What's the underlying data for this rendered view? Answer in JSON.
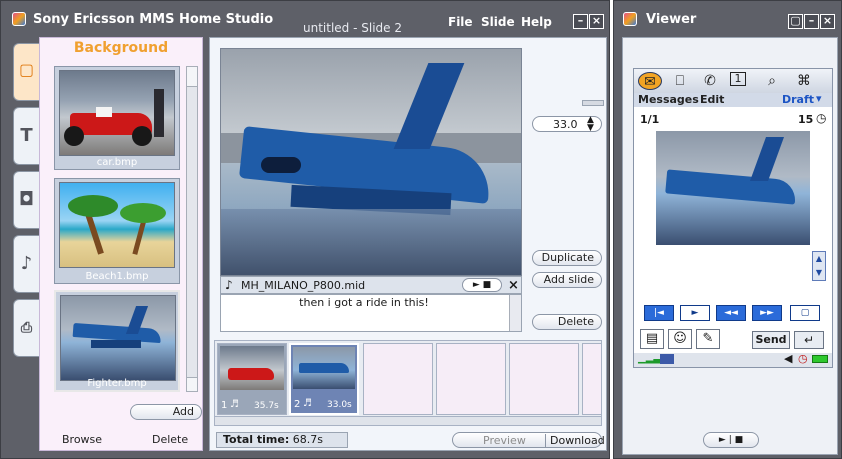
{
  "app": {
    "title": "Sony Ericsson MMS Home Studio",
    "doc_title": "untitled - Slide 2",
    "menu": [
      "File",
      "Slide",
      "Help"
    ]
  },
  "left_panel": {
    "header": "Background",
    "thumbnails": [
      {
        "caption": "car.bmp"
      },
      {
        "caption": "Beach1.bmp"
      },
      {
        "caption": "Fighter.bmp"
      }
    ],
    "add_label": "Add",
    "browse_label": "Browse",
    "delete_label": "Delete"
  },
  "tabs": [
    {
      "icon": "image-icon",
      "glyph": "▢"
    },
    {
      "icon": "text-icon",
      "glyph": "T"
    },
    {
      "icon": "frame-icon",
      "glyph": "◘"
    },
    {
      "icon": "music-note-icon",
      "glyph": "♪"
    },
    {
      "icon": "microphone-icon",
      "glyph": "⎙"
    }
  ],
  "editor": {
    "audio_file": "MH_MILANO_P800.mid",
    "caption_text": "then i got a ride in this!",
    "duration_value": "33.0",
    "duplicate_label": "Duplicate",
    "add_slide_label": "Add slide",
    "delete_label": "Delete"
  },
  "slides": [
    {
      "number": "1",
      "duration": "35.7s"
    },
    {
      "number": "2",
      "duration": "33.0s"
    }
  ],
  "footer": {
    "total_time_label": "Total time:",
    "total_time_value": "68.7s",
    "preview_label": "Preview",
    "download_label": "Download"
  },
  "viewer": {
    "title": "Viewer",
    "menu_messages": "Messages",
    "menu_edit": "Edit",
    "draft_label": "Draft",
    "page_counter": "1/1",
    "time_left": "15",
    "send_label": "Send",
    "top_icons": [
      "envelope-icon",
      "book-icon",
      "phone-icon",
      "calendar-icon",
      "search-icon",
      "apps-icon"
    ],
    "top_icon_glyphs": [
      "✉",
      "⎕",
      "✆",
      "1",
      "⌕",
      "⌘"
    ]
  }
}
